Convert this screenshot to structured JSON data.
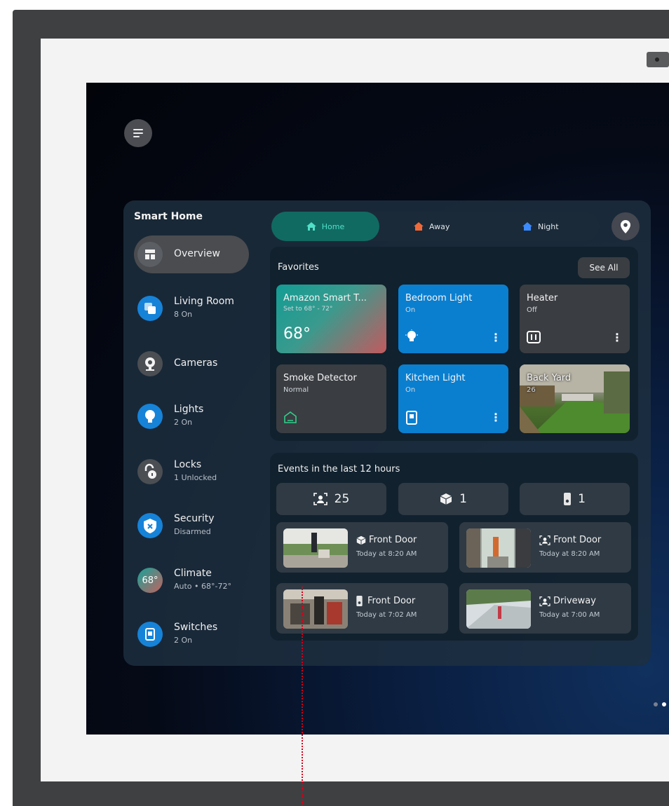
{
  "colors": {
    "teal_accent": "#4fe0c8",
    "home_mode_bg": "#116a62",
    "light_tile_blue": "#0a7fd0",
    "nav_icon_blue": "#1683d8",
    "away_icon": "#ef6a3a",
    "night_icon": "#3b8bff",
    "pointer_line": "#d0021b"
  },
  "sidebar": {
    "title": "Smart Home",
    "items": [
      {
        "label": "Overview",
        "sub": "",
        "icon": "grid-icon"
      },
      {
        "label": "Living Room",
        "sub": "8 On",
        "icon": "rooms-icon"
      },
      {
        "label": "Cameras",
        "sub": "",
        "icon": "camera-icon"
      },
      {
        "label": "Lights",
        "sub": "2 On",
        "icon": "bulb-icon"
      },
      {
        "label": "Locks",
        "sub": "1 Unlocked",
        "icon": "unlocked-lock-icon"
      },
      {
        "label": "Security",
        "sub": "Disarmed",
        "icon": "shield-icon"
      },
      {
        "label": "Climate",
        "sub": "Auto • 68°-72°",
        "icon": "thermostat-badge",
        "badge": "68°"
      },
      {
        "label": "Switches",
        "sub": "2 On",
        "icon": "switch-icon"
      }
    ]
  },
  "modes": [
    {
      "label": "Home",
      "icon": "home-icon",
      "active": true
    },
    {
      "label": "Away",
      "icon": "home-icon",
      "active": false
    },
    {
      "label": "Night",
      "icon": "home-icon",
      "active": false
    }
  ],
  "favorites": {
    "title": "Favorites",
    "see_all": "See All",
    "tiles": [
      {
        "title": "Amazon Smart T...",
        "sub": "Set to 68° - 72°",
        "value": "68°"
      },
      {
        "title": "Bedroom Light",
        "sub": "On"
      },
      {
        "title": "Heater",
        "sub": "Off"
      },
      {
        "title": "Smoke Detector",
        "sub": "Normal"
      },
      {
        "title": "Kitchen Light",
        "sub": "On"
      },
      {
        "title": "Back Yard",
        "sub": "26"
      }
    ]
  },
  "events": {
    "title": "Events in the last 12 hours",
    "stats": [
      {
        "icon": "person-detect-icon",
        "count": "25"
      },
      {
        "icon": "package-icon",
        "count": "1"
      },
      {
        "icon": "doorbell-icon",
        "count": "1"
      }
    ],
    "items": [
      {
        "icon": "package-icon",
        "title": "Front Door",
        "time": "Today at 8:20 AM"
      },
      {
        "icon": "person-detect-icon",
        "title": "Front Door",
        "time": "Today at 8:20 AM"
      },
      {
        "icon": "doorbell-icon",
        "title": "Front Door",
        "time": "Today at 7:02 AM"
      },
      {
        "icon": "person-detect-icon",
        "title": "Driveway",
        "time": "Today at 7:00 AM"
      }
    ]
  }
}
